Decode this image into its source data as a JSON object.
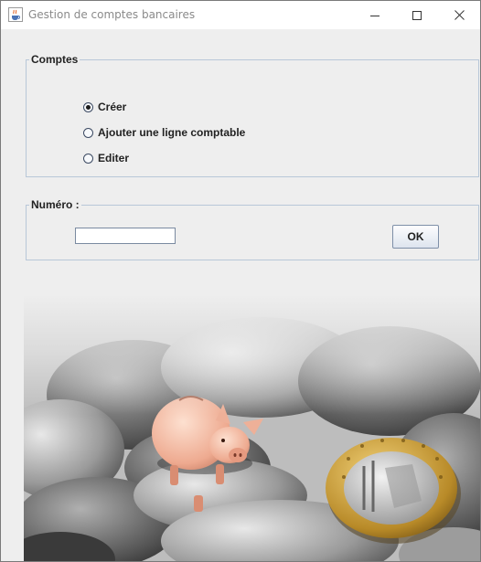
{
  "window": {
    "title": "Gestion de comptes bancaires",
    "icon": "java-cup-icon",
    "controls": [
      "minimize-icon",
      "maximize-icon",
      "close-icon"
    ]
  },
  "comptes": {
    "legend": "Comptes",
    "options": [
      {
        "label": "Créer",
        "selected": true
      },
      {
        "label": "Ajouter une ligne comptable",
        "selected": false
      },
      {
        "label": "Editer",
        "selected": false
      }
    ]
  },
  "numero": {
    "legend": "Numéro :",
    "value": "",
    "button_label": "OK"
  },
  "image": {
    "subject": "piggy bank with coins and a 1 euro coin"
  },
  "colors": {
    "border": "#b8c7d8",
    "background": "#eeeeee"
  }
}
